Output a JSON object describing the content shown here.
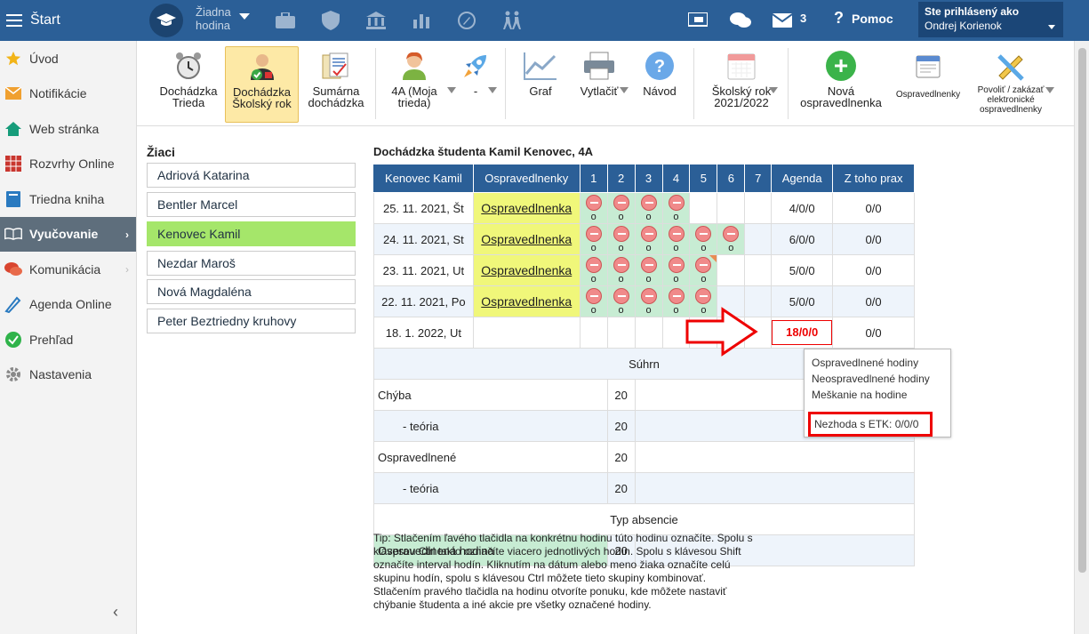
{
  "topbar": {
    "start_label": "Štart",
    "hour_label_1": "Žiadna",
    "hour_label_2": "hodina",
    "messages_count": "3",
    "help_label": "Pomoc",
    "help_glyph": "?",
    "user_label": "Ste prihlásený ako",
    "user_name": "Ondrej Korienok"
  },
  "sidebar": {
    "items": [
      {
        "label": "Úvod",
        "icon": "star-icon"
      },
      {
        "label": "Notifikácie",
        "icon": "envelope-icon"
      },
      {
        "label": "Web stránka",
        "icon": "home-icon"
      },
      {
        "label": "Rozvrhy Online",
        "icon": "schedule-icon"
      },
      {
        "label": "Triedna kniha",
        "icon": "book-icon"
      },
      {
        "label": "Vyučovanie",
        "icon": "open-book-icon"
      },
      {
        "label": "Komunikácia",
        "icon": "chat-icon"
      },
      {
        "label": "Agenda Online",
        "icon": "pen-icon"
      },
      {
        "label": "Prehľad",
        "icon": "check-icon"
      },
      {
        "label": "Nastavenia",
        "icon": "gear-icon"
      }
    ],
    "collapse_glyph": "‹"
  },
  "toolbar": {
    "items": [
      {
        "l1": "Dochádzka",
        "l2": "Trieda"
      },
      {
        "l1": "Dochádzka",
        "l2": "Školský rok"
      },
      {
        "l1": "Sumárna",
        "l2": "dochádzka"
      },
      {
        "l1": "4A (Moja",
        "l2": "trieda)"
      },
      {
        "l1": "-",
        "l2": ""
      },
      {
        "l1": "Graf",
        "l2": ""
      },
      {
        "l1": "Vytlačiť",
        "l2": ""
      },
      {
        "l1": "Návod",
        "l2": ""
      },
      {
        "l1": "Školský rok",
        "l2": "2021/2022"
      },
      {
        "l1": "Nová",
        "l2": "ospravedlnenka"
      },
      {
        "l1": "Ospravedlnenky",
        "l2": ""
      },
      {
        "l1": "Povoliť / zakázať",
        "l2": "elektronické",
        "l3": "ospravedlnenky"
      }
    ],
    "help_glyph": "?",
    "plus_glyph": "+"
  },
  "students": {
    "title": "Žiaci",
    "list": [
      "Adriová Katarina",
      "Bentler Marcel",
      "Kenovec Kamil",
      "Nezdar Maroš",
      "Nová Magdaléna",
      "Peter Beztriedny kruhovy"
    ]
  },
  "attendance": {
    "title": "Dochádzka študenta Kamil Kenovec, 4A",
    "headers": [
      "Kenovec Kamil",
      "Ospravedlnenky",
      "1",
      "2",
      "3",
      "4",
      "5",
      "6",
      "7",
      "Agenda",
      "Z toho prax"
    ],
    "rows": [
      {
        "date": "25. 11. 2021, Št",
        "excuse": "Ospravedlnenka",
        "agenda": "4/0/0",
        "prax": "0/0"
      },
      {
        "date": "24. 11. 2021, St",
        "excuse": "Ospravedlnenka",
        "agenda": "6/0/0",
        "prax": "0/0"
      },
      {
        "date": "23. 11. 2021, Ut",
        "excuse": "Ospravedlnenka",
        "agenda": "5/0/0",
        "prax": "0/0"
      },
      {
        "date": "22. 11. 2021, Po",
        "excuse": "Ospravedlnenka",
        "agenda": "5/0/0",
        "prax": "0/0"
      },
      {
        "date": "18. 1. 2022, Ut",
        "excuse": "",
        "agenda": "18/0/0",
        "prax": "0/0"
      }
    ],
    "mark": "o",
    "summary_title": "Súhrn",
    "summary": [
      {
        "label": "Chýba",
        "value": "20"
      },
      {
        "label": "- teória",
        "value": "20"
      },
      {
        "label": "Ospravedlnené",
        "value": "20"
      },
      {
        "label": "- teória",
        "value": "20"
      }
    ],
    "type_title": "Typ absencie",
    "type_rows": [
      {
        "label": "Ospravedlnená hodina",
        "value": "20"
      }
    ]
  },
  "tooltip": {
    "line1": "Ospravedlnené hodiny",
    "line2": "Neospravedlnené hodiny",
    "line3": "Meškanie na hodine",
    "etk": "Nezhoda s ETK: 0/0/0"
  },
  "tip": {
    "p1": "Tip: Stlačením ľavého tlačidla na konkrétnu hodinu túto hodinu označíte. Spolu s klávesou Ctrl takto označíte viacero jednotlivých hodín. Spolu s klávesou Shift označíte interval hodín. Kliknutím na dátum alebo meno žiaka označíte celú skupinu hodín, spolu s klávesou Ctrl môžete tieto skupiny kombinovať.",
    "p2": "Stlačením pravého tlačidla na hodinu otvoríte ponuku, kde môžete nastaviť chýbanie študenta a iné akcie pre všetky označené hodiny."
  }
}
